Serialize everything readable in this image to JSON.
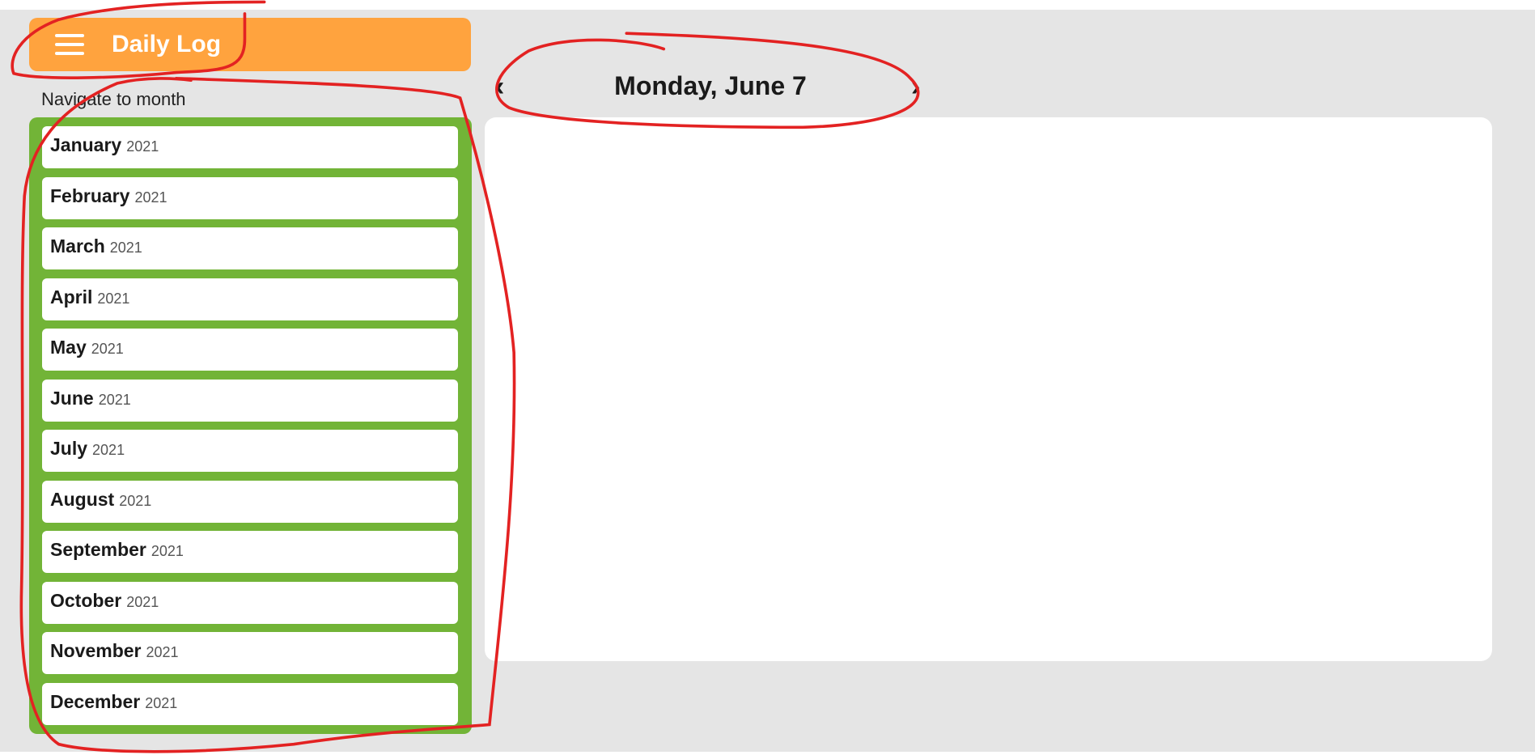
{
  "header": {
    "title": "Daily Log",
    "menu_icon": "hamburger-icon"
  },
  "sidebar": {
    "label": "Navigate to month",
    "months": [
      {
        "month": "January",
        "year": "2021"
      },
      {
        "month": "February",
        "year": "2021"
      },
      {
        "month": "March",
        "year": "2021"
      },
      {
        "month": "April",
        "year": "2021"
      },
      {
        "month": "May",
        "year": "2021"
      },
      {
        "month": "June",
        "year": "2021"
      },
      {
        "month": "July",
        "year": "2021"
      },
      {
        "month": "August",
        "year": "2021"
      },
      {
        "month": "September",
        "year": "2021"
      },
      {
        "month": "October",
        "year": "2021"
      },
      {
        "month": "November",
        "year": "2021"
      },
      {
        "month": "December",
        "year": "2021"
      }
    ]
  },
  "day_nav": {
    "date": "Monday, June 7",
    "prev": "‹",
    "next": "›"
  },
  "colors": {
    "header": "#ffa33e",
    "sidebar": "#72b437",
    "background": "#e5e5e5",
    "annotation": "#e32222"
  }
}
